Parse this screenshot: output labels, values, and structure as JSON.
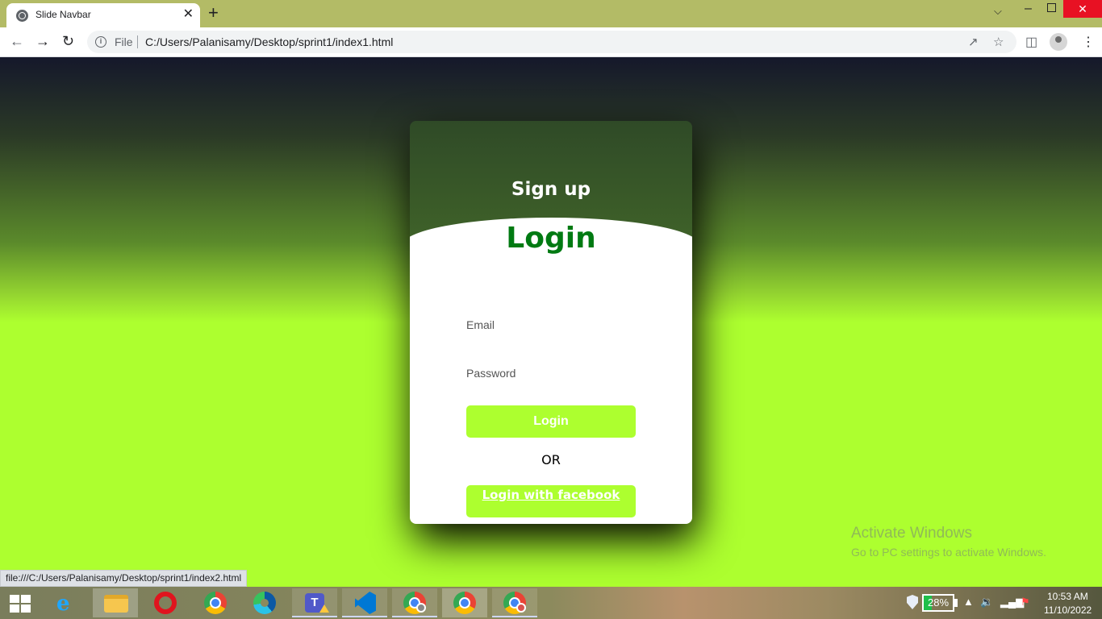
{
  "browser": {
    "tab_title": "Slide Navbar",
    "tab_close": "✕",
    "new_tab": "+",
    "address_scheme": "File",
    "address_url": "C:/Users/Palanisamy/Desktop/sprint1/index1.html",
    "status_url": "file:///C:/Users/Palanisamy/Desktop/sprint1/index2.html"
  },
  "page": {
    "signup_label": "Sign up",
    "login_title": "Login",
    "email_placeholder": "Email",
    "password_placeholder": "Password",
    "login_button": "Login",
    "or_text": "OR",
    "facebook_button": "Login with facebook",
    "colors": {
      "accent": "#adff2f",
      "login_title": "#007a12"
    }
  },
  "watermark": {
    "title": "Activate Windows",
    "subtitle": "Go to PC settings to activate Windows."
  },
  "taskbar": {
    "apps": [
      "start-icon",
      "internet-explorer-icon",
      "file-explorer-icon",
      "opera-icon",
      "chrome-icon",
      "edge-icon",
      "teams-icon",
      "vscode-icon",
      "chrome-profile-icon",
      "chrome-icon",
      "chrome-profile-icon"
    ],
    "battery_percent": "28%",
    "battery_level": 0.28,
    "time": "10:53 AM",
    "date": "11/10/2022"
  }
}
